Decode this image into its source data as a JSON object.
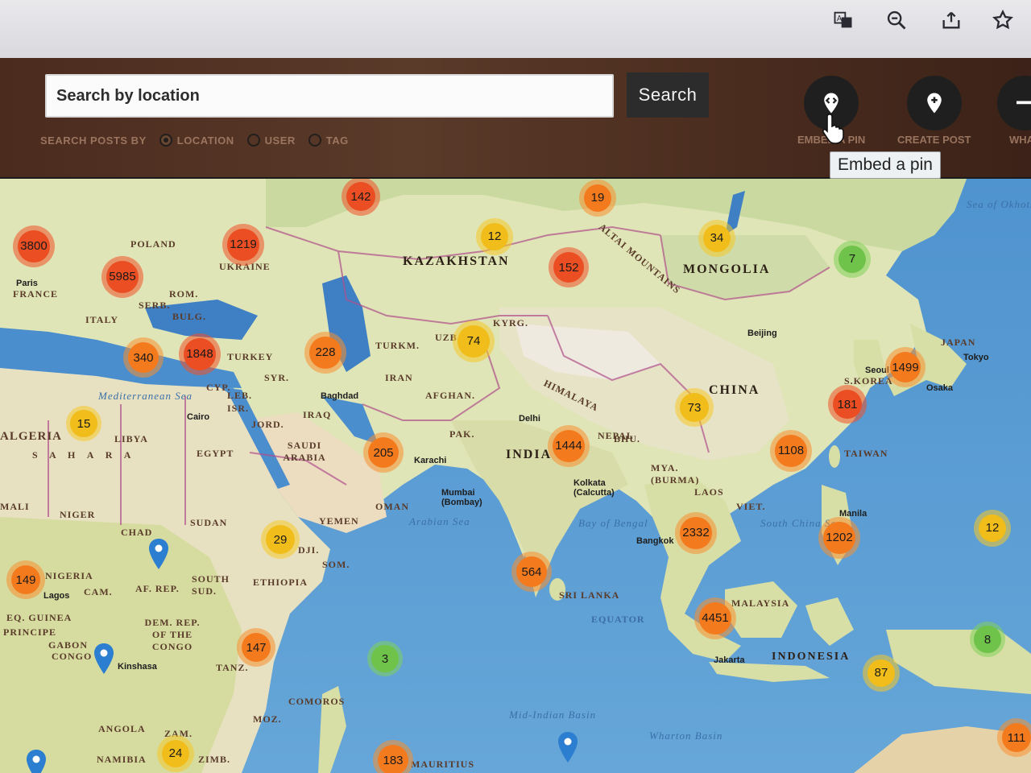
{
  "browser": {
    "icons": [
      "translate-icon",
      "zoom-out-icon",
      "share-icon",
      "star-icon"
    ]
  },
  "header": {
    "search_placeholder": "Search by location",
    "search_button": "Search",
    "search_by_label": "SEARCH POSTS BY",
    "search_options": [
      {
        "label": "LOCATION",
        "selected": true
      },
      {
        "label": "USER",
        "selected": false
      },
      {
        "label": "TAG",
        "selected": false
      }
    ],
    "tools": [
      {
        "label": "EMBED A PIN",
        "icon": "embed-code-icon"
      },
      {
        "label": "CREATE POST",
        "icon": "add-location-icon"
      },
      {
        "label": "WHAT",
        "icon": "menu-icon"
      }
    ],
    "tooltip": "Embed a pin"
  },
  "map": {
    "labels": {
      "kazakhstan": "KAZAKHSTAN",
      "mongolia": "MONGOLIA",
      "china": "CHINA",
      "india": "INDIA",
      "turkey": "TURKEY",
      "algeria": "ALGERIA",
      "libya": "LIBYA",
      "egypt": "EGYPT",
      "sudan": "SUDAN",
      "niger": "NIGER",
      "chad": "CHAD",
      "saudi": "SAUDI ARABIA",
      "iran": "IRAN",
      "iraq": "IRAQ",
      "oman": "OMAN",
      "yemen": "YEMEN",
      "ethiopia": "ETHIOPIA",
      "afghan": "AFGHAN.",
      "pak": "PAK.",
      "turkm": "TURKM.",
      "uzb": "UZB.",
      "kyrg": "KYRG.",
      "ukraine": "UKRAINE",
      "poland": "POLAND",
      "france": "FRANCE",
      "italy": "ITALY",
      "bulg": "BULG.",
      "rom": "ROM.",
      "serb": "SERB.",
      "syr": "SYR.",
      "jord": "JORD.",
      "cyp": "CYP.",
      "leb": "LEB.",
      "isr": "ISR.",
      "japan": "JAPAN",
      "skorea": "S.KOREA",
      "taiwan": "TAIWAN",
      "laos": "LAOS",
      "viet": "VIET.",
      "mya": "MYA. (BURMA)",
      "malaysia": "MALAYSIA",
      "indonesia": "INDONESIA",
      "srilanka": "SRI LANKA",
      "equator": "EQUATOR",
      "himalaya": "HIMALAYA",
      "altai": "ALTAI MOUNTAINS",
      "arabian_sea": "Arabian Sea",
      "bay_bengal": "Bay of Bengal",
      "south_china_sea": "South China Sea",
      "mediterranean": "Mediterranean Sea",
      "sea_okhotsk": "Sea of Okhotsk",
      "mid_indian": "Mid-Indian Basin",
      "wharton": "Wharton Basin",
      "sahara": "S A H A R A",
      "nigeria": "NIGERIA",
      "cam": "CAM.",
      "af_rep": "AF. REP.",
      "south_sud": "SOUTH SUD.",
      "dem_rep": "DEM. REP. OF THE CONGO",
      "gabon": "GABON",
      "congo": "CONGO",
      "angola": "ANGOLA",
      "namibia": "NAMIBIA",
      "zimb": "ZIMB.",
      "zam": "ZAM.",
      "moz": "MOZ.",
      "tanz": "TANZ.",
      "comoros": "COMOROS",
      "som": "SOM.",
      "dji": "DJI.",
      "eq_guinea": "EQ. GUINEA",
      "principe": "PRINCIPE",
      "mali": "MALI",
      "mauritius": "MAURITIUS",
      "delhi": "Delhi",
      "karachi": "Karachi",
      "mumbai": "Mumbai (Bombay)",
      "kolkata": "Kolkata (Calcutta)",
      "bangkok": "Bangkok",
      "baghdad": "Baghdad",
      "cairo": "Cairo",
      "paris": "Paris",
      "beijing": "Beijing",
      "seoul": "Seoul",
      "osaka": "Osaka",
      "tokyo": "Tokyo",
      "manila": "Manila",
      "jakarta": "Jakarta",
      "kinshasa": "Kinshasa",
      "lagos": "Lagos",
      "nepal": "NEPAL",
      "bhu": "BHU."
    },
    "clusters": [
      {
        "count": "142",
        "color": "red"
      },
      {
        "count": "19",
        "color": "orange"
      },
      {
        "count": "3800",
        "color": "red"
      },
      {
        "count": "1219",
        "color": "red"
      },
      {
        "count": "12",
        "color": "yellow"
      },
      {
        "count": "34",
        "color": "yellow"
      },
      {
        "count": "7",
        "color": "green"
      },
      {
        "count": "5985",
        "color": "red"
      },
      {
        "count": "152",
        "color": "red"
      },
      {
        "count": "74",
        "color": "yellow"
      },
      {
        "count": "340",
        "color": "orange"
      },
      {
        "count": "1848",
        "color": "red"
      },
      {
        "count": "228",
        "color": "orange"
      },
      {
        "count": "1499",
        "color": "orange"
      },
      {
        "count": "15",
        "color": "yellow"
      },
      {
        "count": "73",
        "color": "yellow"
      },
      {
        "count": "181",
        "color": "red"
      },
      {
        "count": "205",
        "color": "orange"
      },
      {
        "count": "1444",
        "color": "orange"
      },
      {
        "count": "1108",
        "color": "orange"
      },
      {
        "count": "29",
        "color": "yellow"
      },
      {
        "count": "2332",
        "color": "orange"
      },
      {
        "count": "1202",
        "color": "orange"
      },
      {
        "count": "12",
        "color": "yellow"
      },
      {
        "count": "149",
        "color": "orange"
      },
      {
        "count": "564",
        "color": "orange"
      },
      {
        "count": "4451",
        "color": "orange"
      },
      {
        "count": "147",
        "color": "orange"
      },
      {
        "count": "3",
        "color": "green"
      },
      {
        "count": "8",
        "color": "green"
      },
      {
        "count": "87",
        "color": "yellow"
      },
      {
        "count": "24",
        "color": "yellow"
      },
      {
        "count": "183",
        "color": "orange"
      },
      {
        "count": "111",
        "color": "orange"
      }
    ]
  }
}
